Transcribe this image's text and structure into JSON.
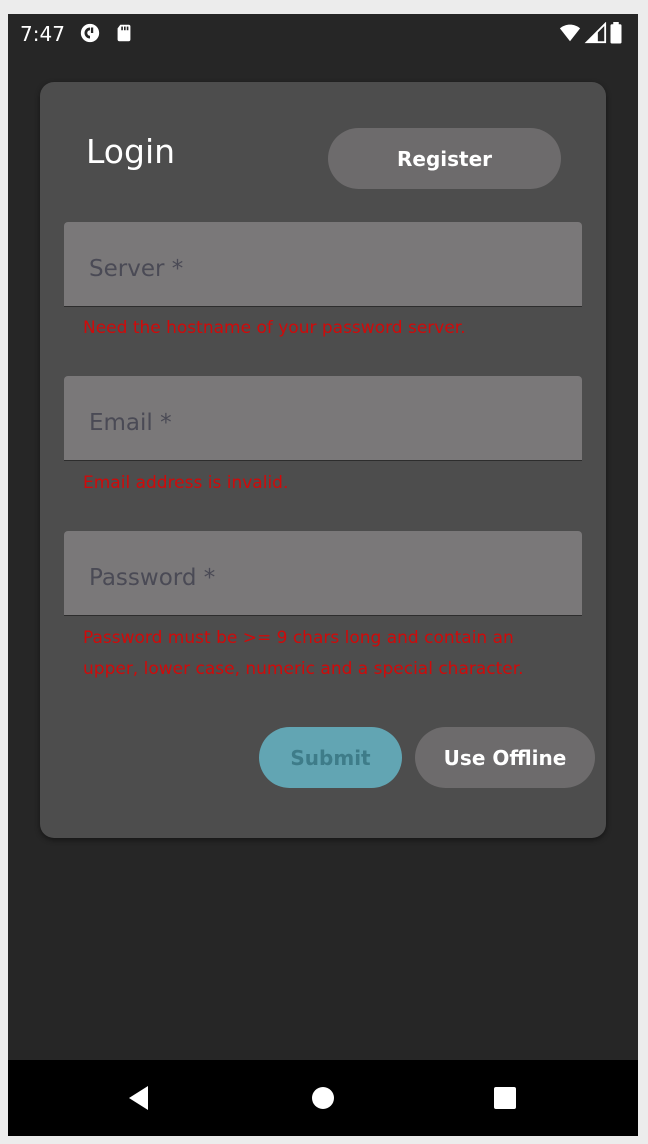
{
  "status_bar": {
    "time": "7:47",
    "left_icons": [
      "pocket-casts-icon",
      "sd-card-icon"
    ],
    "right_icons": [
      "wifi-icon",
      "cell-signal-icon",
      "battery-icon"
    ]
  },
  "login_card": {
    "title": "Login",
    "register_label": "Register",
    "fields": [
      {
        "label": "Server *",
        "error": "Need the hostname of your password server."
      },
      {
        "label": "Email *",
        "error": "Email address is invalid."
      },
      {
        "label": "Password *",
        "error": "Password must be >= 9 chars long and contain an upper, lower case, numeric and a special character."
      }
    ],
    "submit_label": "Submit",
    "offline_label": "Use Offline"
  },
  "nav_bar": {
    "buttons": [
      "back-icon",
      "home-icon",
      "recents-icon"
    ]
  },
  "colors": {
    "background": "#262626",
    "card": "#4d4d4d",
    "field": "#7a7879",
    "error": "#d00a0a",
    "submit": "#62a5b3",
    "pill": "#6d6b6c"
  }
}
